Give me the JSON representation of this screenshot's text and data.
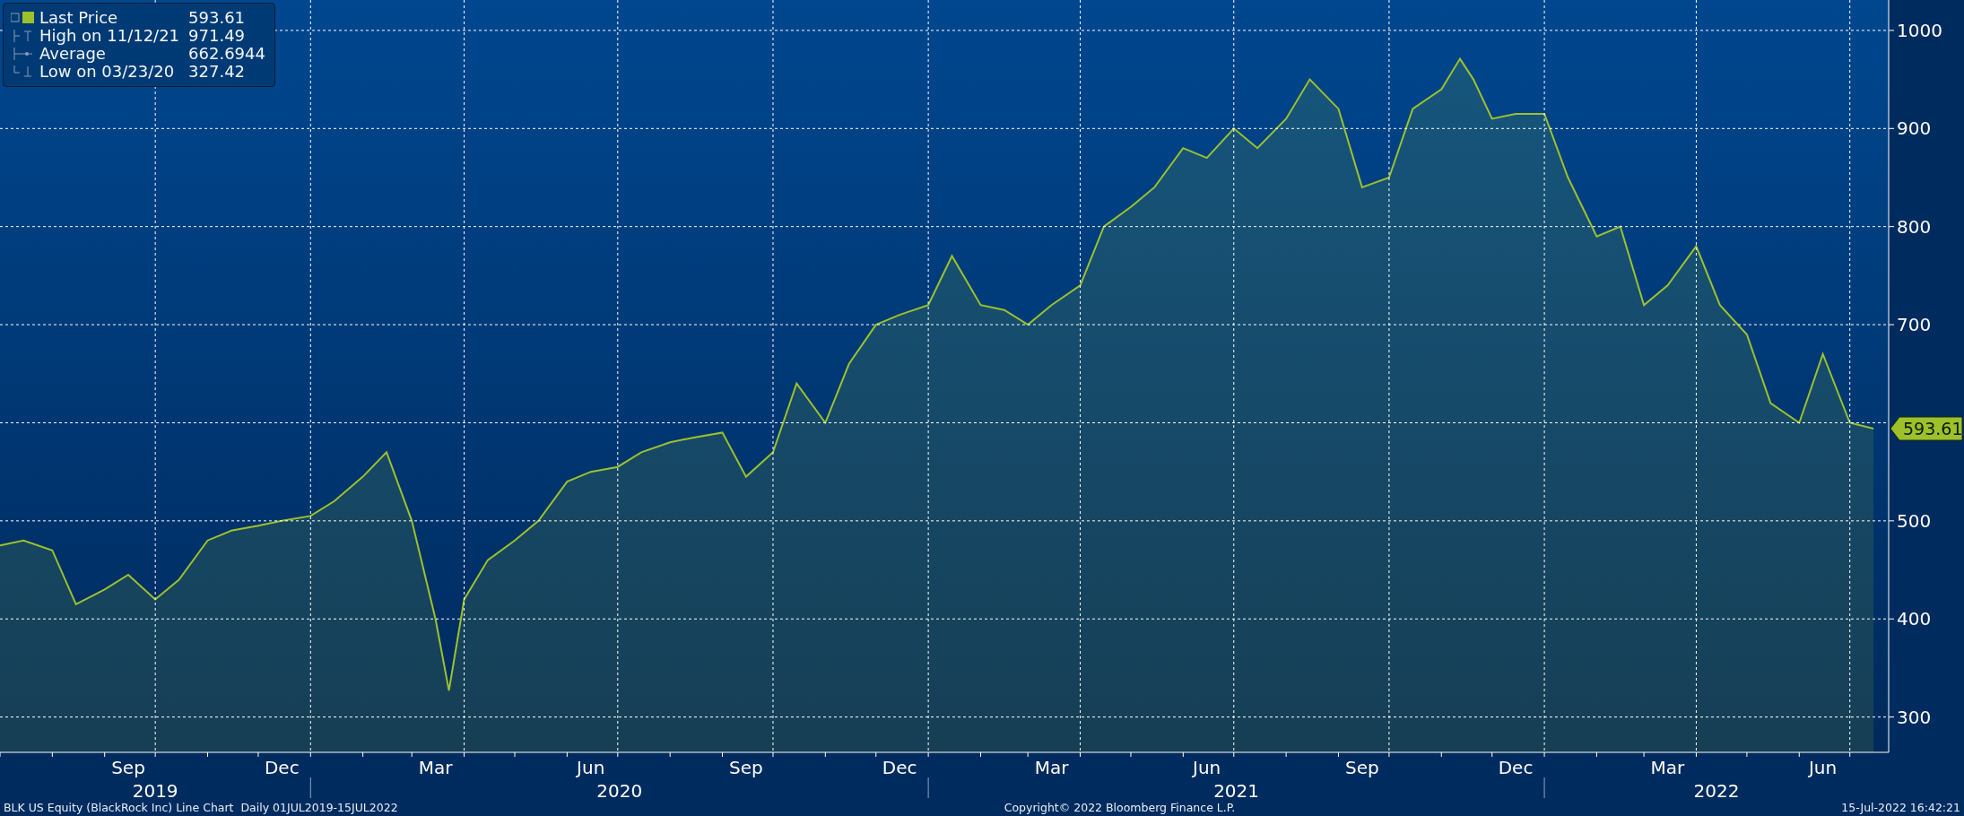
{
  "legend": {
    "items": [
      {
        "kind": "last",
        "value": "593.61",
        "color": "#9dc12b"
      },
      {
        "kind": "high",
        "label": "High on 11/12/21",
        "value": "971.49"
      },
      {
        "kind": "average",
        "label": "Average",
        "value": "662.6944"
      },
      {
        "kind": "low",
        "label": "Low on 03/23/20",
        "value": "327.42"
      }
    ]
  },
  "chart": {
    "chart_data": {
      "type": "area",
      "grid": true,
      "xlim": [
        "2019-07-01",
        "2022-07-24"
      ],
      "ylim": [
        264,
        1031
      ],
      "yticks": [
        300,
        400,
        500,
        700,
        800,
        900,
        1000
      ],
      "xticks": [
        {
          "value": "2019-09-15",
          "label": "Sep"
        },
        {
          "value": "2019-12-15",
          "label": "Dec"
        },
        {
          "value": "2020-03-15",
          "label": "Mar"
        },
        {
          "value": "2020-06-15",
          "label": "Jun"
        },
        {
          "value": "2020-09-15",
          "label": "Sep"
        },
        {
          "value": "2020-12-15",
          "label": "Dec"
        },
        {
          "value": "2021-03-15",
          "label": "Mar"
        },
        {
          "value": "2021-06-15",
          "label": "Jun"
        },
        {
          "value": "2021-09-15",
          "label": "Sep"
        },
        {
          "value": "2021-12-15",
          "label": "Dec"
        },
        {
          "value": "2022-03-15",
          "label": "Mar"
        },
        {
          "value": "2022-06-15",
          "label": "Jun"
        }
      ],
      "x": [
        "2019-07-01",
        "2019-07-15",
        "2019-08-01",
        "2019-08-15",
        "2019-09-01",
        "2019-09-15",
        "2019-10-01",
        "2019-10-15",
        "2019-11-01",
        "2019-11-15",
        "2019-12-01",
        "2019-12-15",
        "2020-01-01",
        "2020-01-15",
        "2020-02-01",
        "2020-02-15",
        "2020-03-01",
        "2020-03-15",
        "2020-03-23",
        "2020-04-01",
        "2020-04-15",
        "2020-05-01",
        "2020-05-15",
        "2020-06-01",
        "2020-06-15",
        "2020-07-01",
        "2020-07-15",
        "2020-08-01",
        "2020-08-15",
        "2020-09-01",
        "2020-09-15",
        "2020-10-01",
        "2020-10-15",
        "2020-11-01",
        "2020-11-15",
        "2020-12-01",
        "2020-12-15",
        "2021-01-01",
        "2021-01-15",
        "2021-02-01",
        "2021-02-15",
        "2021-03-01",
        "2021-03-15",
        "2021-04-01",
        "2021-04-15",
        "2021-05-01",
        "2021-05-15",
        "2021-06-01",
        "2021-06-15",
        "2021-07-01",
        "2021-07-15",
        "2021-08-01",
        "2021-08-15",
        "2021-09-01",
        "2021-09-15",
        "2021-10-01",
        "2021-10-15",
        "2021-11-01",
        "2021-11-12",
        "2021-11-20",
        "2021-12-01",
        "2021-12-15",
        "2022-01-01",
        "2022-01-15",
        "2022-02-01",
        "2022-02-15",
        "2022-03-01",
        "2022-03-15",
        "2022-04-01",
        "2022-04-15",
        "2022-05-01",
        "2022-05-15",
        "2022-06-01",
        "2022-06-15",
        "2022-07-01",
        "2022-07-15"
      ],
      "series": [
        {
          "name": "Last Price",
          "color": "#9dc12b",
          "values": [
            475,
            480,
            470,
            415,
            430,
            445,
            420,
            440,
            480,
            490,
            495,
            500,
            505,
            520,
            545,
            570,
            500,
            400,
            327,
            420,
            460,
            480,
            500,
            540,
            550,
            555,
            570,
            580,
            585,
            590,
            545,
            570,
            640,
            600,
            660,
            700,
            710,
            720,
            770,
            720,
            715,
            700,
            720,
            740,
            800,
            820,
            840,
            880,
            870,
            900,
            880,
            910,
            950,
            920,
            840,
            850,
            920,
            940,
            971,
            950,
            910,
            915,
            915,
            850,
            790,
            800,
            720,
            740,
            780,
            720,
            690,
            620,
            600,
            670,
            600,
            594
          ]
        }
      ]
    },
    "price_tag": {
      "label": "593.61"
    },
    "years": [
      {
        "label": "2019"
      },
      {
        "label": "2020"
      },
      {
        "label": "2021"
      },
      {
        "label": "2022"
      }
    ]
  },
  "footer": {
    "description": "BLK US Equity (BlackRock Inc) Line Chart  Daily 01JUL2019-15JUL2022",
    "copyright": "Copyright© 2022 Bloomberg Finance L.P.",
    "timestamp": "15-Jul-2022 16:42:21"
  }
}
